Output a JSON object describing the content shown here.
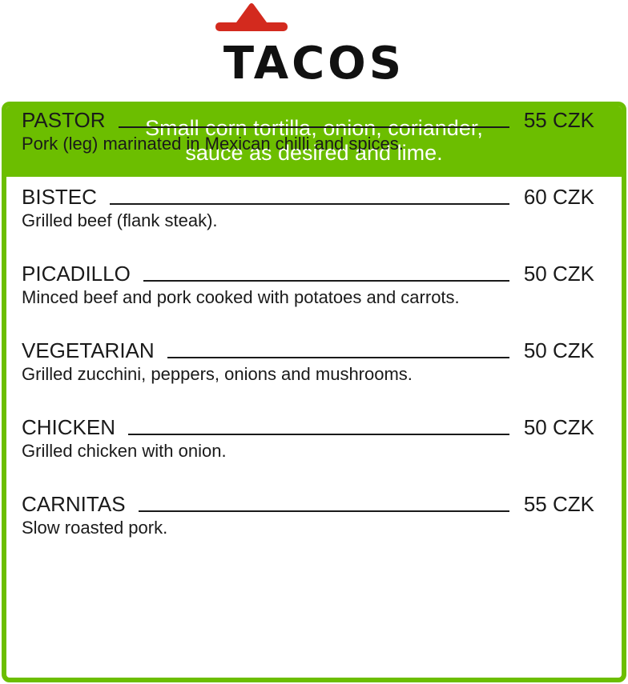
{
  "header": {
    "title": "TACOS",
    "logo_icon": "sombrero-icon",
    "logo_color": "#d32a1e"
  },
  "card": {
    "accent_color": "#6cbe00",
    "intro_line1": "Small corn tortilla, onion, coriander,",
    "intro_line2": "sauce as desired and lime."
  },
  "menu": [
    {
      "name": "PASTOR",
      "price": "55 CZK",
      "description": "Pork (leg) marinated in Mexican chilli and spices."
    },
    {
      "name": "BISTEC",
      "price": "60 CZK",
      "description": "Grilled beef (flank steak)."
    },
    {
      "name": "PICADILLO",
      "price": "50 CZK",
      "description": "Minced beef and pork cooked with potatoes and carrots."
    },
    {
      "name": "VEGETARIAN",
      "price": "50 CZK",
      "description": "Grilled zucchini, peppers, onions and mushrooms."
    },
    {
      "name": "CHICKEN",
      "price": "50 CZK",
      "description": "Grilled chicken with onion."
    },
    {
      "name": "CARNITAS",
      "price": "55 CZK",
      "description": "Slow roasted pork."
    }
  ]
}
